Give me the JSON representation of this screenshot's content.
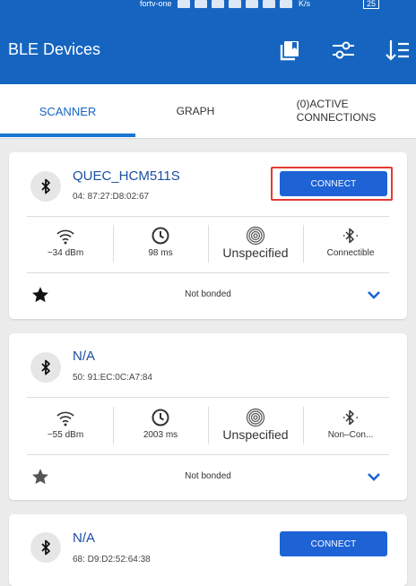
{
  "status_bar": {
    "carrier": "fortv-one",
    "speed": "K/s",
    "battery": "25"
  },
  "app_bar": {
    "title": "BLE Devices"
  },
  "tabs": [
    {
      "label": "SCANNER"
    },
    {
      "label": "GRAPH"
    },
    {
      "label_line1": "(0)ACTIVE",
      "label_line2": "CONNECTIONS"
    }
  ],
  "devices": [
    {
      "name": "QUEC_HCM511S",
      "mac": "04: 87:27:D8:02:67",
      "connect_label": "CONNECT",
      "rssi": "−34 dBm",
      "interval": "98 ms",
      "beacon": "Unspecified",
      "connectable": "Connectible",
      "bond": "Not bonded"
    },
    {
      "name": "N/A",
      "mac": "50: 91:EC:0C:A7:84",
      "rssi": "−55 dBm",
      "interval": "2003 ms",
      "beacon": "Unspecified",
      "connectable": "Non–Con...",
      "bond": "Not bonded"
    },
    {
      "name": "N/A",
      "mac": "68: D9:D2:52:64:38",
      "connect_label": "CONNECT"
    }
  ],
  "colors": {
    "primary": "#1565c0",
    "button": "#1e63d6",
    "highlight": "#e53935"
  },
  "icons": {
    "app_bar": [
      "copy-icon",
      "filter-sliders-icon",
      "sort-icon"
    ],
    "device": [
      "bluetooth-icon",
      "wifi-signal-icon",
      "clock-icon",
      "fingerprint-icon",
      "bluetooth-connectable-icon",
      "star-icon",
      "chevron-down-icon"
    ]
  }
}
